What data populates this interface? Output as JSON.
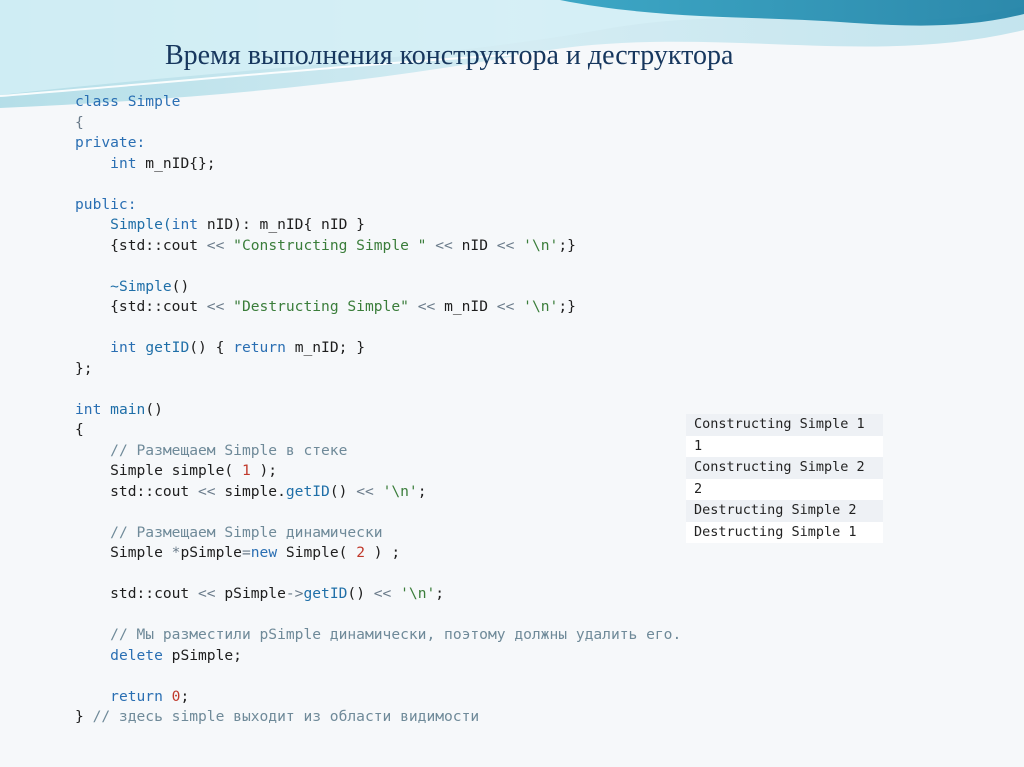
{
  "slide": {
    "title": "Время выполнения конструктора и деструктора"
  },
  "code": {
    "lines": [
      {
        "segs": [
          {
            "t": "class Simple",
            "c": "kw"
          }
        ]
      },
      {
        "segs": [
          {
            "t": "{",
            "c": "op"
          }
        ]
      },
      {
        "segs": [
          {
            "t": "private:",
            "c": "kw"
          }
        ]
      },
      {
        "segs": [
          {
            "t": "    "
          },
          {
            "t": "int",
            "c": "kw"
          },
          {
            "t": " m_nID{};"
          }
        ]
      },
      {
        "segs": [
          {
            "t": ""
          }
        ]
      },
      {
        "segs": [
          {
            "t": "public:",
            "c": "kw"
          }
        ]
      },
      {
        "segs": [
          {
            "t": "    "
          },
          {
            "t": "Simple(",
            "c": "fn"
          },
          {
            "t": "int",
            "c": "kw"
          },
          {
            "t": " nID): m_nID{ nID }"
          }
        ]
      },
      {
        "segs": [
          {
            "t": "    {std::cout "
          },
          {
            "t": "<<",
            "c": "op"
          },
          {
            "t": " "
          },
          {
            "t": "\"Constructing Simple \"",
            "c": "str"
          },
          {
            "t": " "
          },
          {
            "t": "<<",
            "c": "op"
          },
          {
            "t": " nID "
          },
          {
            "t": "<<",
            "c": "op"
          },
          {
            "t": " "
          },
          {
            "t": "'\\n'",
            "c": "str"
          },
          {
            "t": ";}"
          }
        ]
      },
      {
        "segs": [
          {
            "t": ""
          }
        ]
      },
      {
        "segs": [
          {
            "t": "    "
          },
          {
            "t": "~Simple",
            "c": "fn"
          },
          {
            "t": "()"
          }
        ]
      },
      {
        "segs": [
          {
            "t": "    {std::cout "
          },
          {
            "t": "<<",
            "c": "op"
          },
          {
            "t": " "
          },
          {
            "t": "\"Destructing Simple\"",
            "c": "str"
          },
          {
            "t": " "
          },
          {
            "t": "<<",
            "c": "op"
          },
          {
            "t": " m_nID "
          },
          {
            "t": "<<",
            "c": "op"
          },
          {
            "t": " "
          },
          {
            "t": "'\\n'",
            "c": "str"
          },
          {
            "t": ";}"
          }
        ]
      },
      {
        "segs": [
          {
            "t": ""
          }
        ]
      },
      {
        "segs": [
          {
            "t": "    "
          },
          {
            "t": "int",
            "c": "kw"
          },
          {
            "t": " "
          },
          {
            "t": "getID",
            "c": "fn"
          },
          {
            "t": "() { "
          },
          {
            "t": "return",
            "c": "kw"
          },
          {
            "t": " m_nID; }"
          }
        ]
      },
      {
        "segs": [
          {
            "t": "};"
          }
        ]
      },
      {
        "segs": [
          {
            "t": ""
          }
        ]
      },
      {
        "segs": [
          {
            "t": "int",
            "c": "kw"
          },
          {
            "t": " "
          },
          {
            "t": "main",
            "c": "fn"
          },
          {
            "t": "()"
          }
        ]
      },
      {
        "segs": [
          {
            "t": "{"
          }
        ]
      },
      {
        "segs": [
          {
            "t": "    "
          },
          {
            "t": "// Размещаем Simple в стеке",
            "c": "cm"
          }
        ]
      },
      {
        "segs": [
          {
            "t": "    Simple simple( "
          },
          {
            "t": "1",
            "c": "num"
          },
          {
            "t": " );"
          }
        ]
      },
      {
        "segs": [
          {
            "t": "    std::cout "
          },
          {
            "t": "<<",
            "c": "op"
          },
          {
            "t": " simple."
          },
          {
            "t": "getID",
            "c": "fn"
          },
          {
            "t": "() "
          },
          {
            "t": "<<",
            "c": "op"
          },
          {
            "t": " "
          },
          {
            "t": "'\\n'",
            "c": "str"
          },
          {
            "t": ";"
          }
        ]
      },
      {
        "segs": [
          {
            "t": ""
          }
        ]
      },
      {
        "segs": [
          {
            "t": "    "
          },
          {
            "t": "// Размещаем Simple динамически",
            "c": "cm"
          }
        ]
      },
      {
        "segs": [
          {
            "t": "    Simple "
          },
          {
            "t": "*",
            "c": "op"
          },
          {
            "t": "pSimple"
          },
          {
            "t": "=",
            "c": "op"
          },
          {
            "t": "new",
            "c": "kw"
          },
          {
            "t": " Simple( "
          },
          {
            "t": "2",
            "c": "num"
          },
          {
            "t": " ) ;"
          }
        ]
      },
      {
        "segs": [
          {
            "t": ""
          }
        ]
      },
      {
        "segs": [
          {
            "t": "    std::cout "
          },
          {
            "t": "<<",
            "c": "op"
          },
          {
            "t": " pSimple"
          },
          {
            "t": "->",
            "c": "op"
          },
          {
            "t": "getID",
            "c": "fn"
          },
          {
            "t": "() "
          },
          {
            "t": "<<",
            "c": "op"
          },
          {
            "t": " "
          },
          {
            "t": "'\\n'",
            "c": "str"
          },
          {
            "t": ";"
          }
        ]
      },
      {
        "segs": [
          {
            "t": ""
          }
        ]
      },
      {
        "segs": [
          {
            "t": "    "
          },
          {
            "t": "// Мы разместили pSimple динамически, поэтому должны удалить его.",
            "c": "cm"
          }
        ]
      },
      {
        "segs": [
          {
            "t": "    "
          },
          {
            "t": "delete",
            "c": "kw"
          },
          {
            "t": " pSimple;"
          }
        ]
      },
      {
        "segs": [
          {
            "t": ""
          }
        ]
      },
      {
        "segs": [
          {
            "t": "    "
          },
          {
            "t": "return",
            "c": "kw"
          },
          {
            "t": " "
          },
          {
            "t": "0",
            "c": "num"
          },
          {
            "t": ";"
          }
        ]
      },
      {
        "segs": [
          {
            "t": "} "
          },
          {
            "t": "// здесь simple выходит из области видимости",
            "c": "cm"
          }
        ]
      }
    ]
  },
  "console": {
    "lines": [
      "Constructing Simple 1",
      "1",
      "Constructing Simple 2",
      "2",
      "Destructing Simple 2",
      "Destructing Simple 1"
    ]
  }
}
